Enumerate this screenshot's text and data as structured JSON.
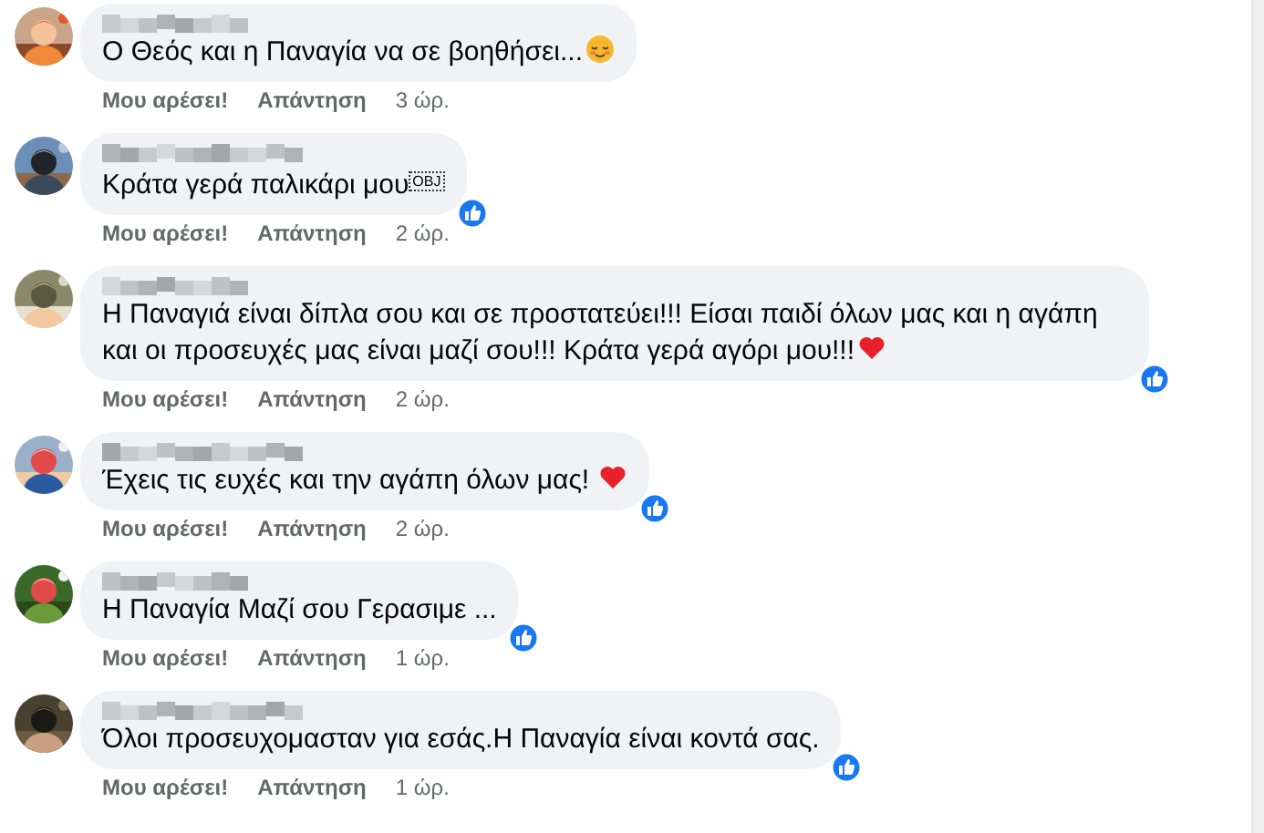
{
  "comments": [
    {
      "text": "Ο Θεός και η Παναγία να σε βοηθήσει...",
      "emoji": {
        "kind": "relieved-face"
      },
      "liked": false,
      "actions": [
        "Μου αρέσει!",
        "Απάντηση"
      ],
      "time": "3 ώρ."
    },
    {
      "text": "Κράτα γερά παλικάρι μου",
      "emoji": {
        "kind": "object-box",
        "label": "OBJ"
      },
      "liked": true,
      "actions": [
        "Μου αρέσει!",
        "Απάντηση"
      ],
      "time": "2 ώρ."
    },
    {
      "text": "Η Παναγιά είναι δίπλα σου και σε προστατεύει!!! Είσαι παιδί όλων μας και η αγάπη και οι προσευχές μας είναι μαζί σου!!! Κράτα γερά αγόρι μου!!!",
      "emoji": {
        "kind": "heart"
      },
      "liked": true,
      "actions": [
        "Μου αρέσει!",
        "Απάντηση"
      ],
      "time": "2 ώρ."
    },
    {
      "text": "Έχεις τις ευχές και την αγάπη όλων μας! ",
      "emoji": {
        "kind": "heart"
      },
      "liked": true,
      "actions": [
        "Μου αρέσει!",
        "Απάντηση"
      ],
      "time": "2 ώρ."
    },
    {
      "text": "Η Παναγία Μαζί σου Γερασιμε ...",
      "liked": true,
      "actions": [
        "Μου αρέσει!",
        "Απάντηση"
      ],
      "time": "1 ώρ."
    },
    {
      "text": "Όλοι προσευχομασταν για εσάς.Η Παναγία είναι κοντά σας.",
      "liked": true,
      "actions": [
        "Μου αρέσει!",
        "Απάντηση"
      ],
      "time": "1 ώρ."
    }
  ]
}
